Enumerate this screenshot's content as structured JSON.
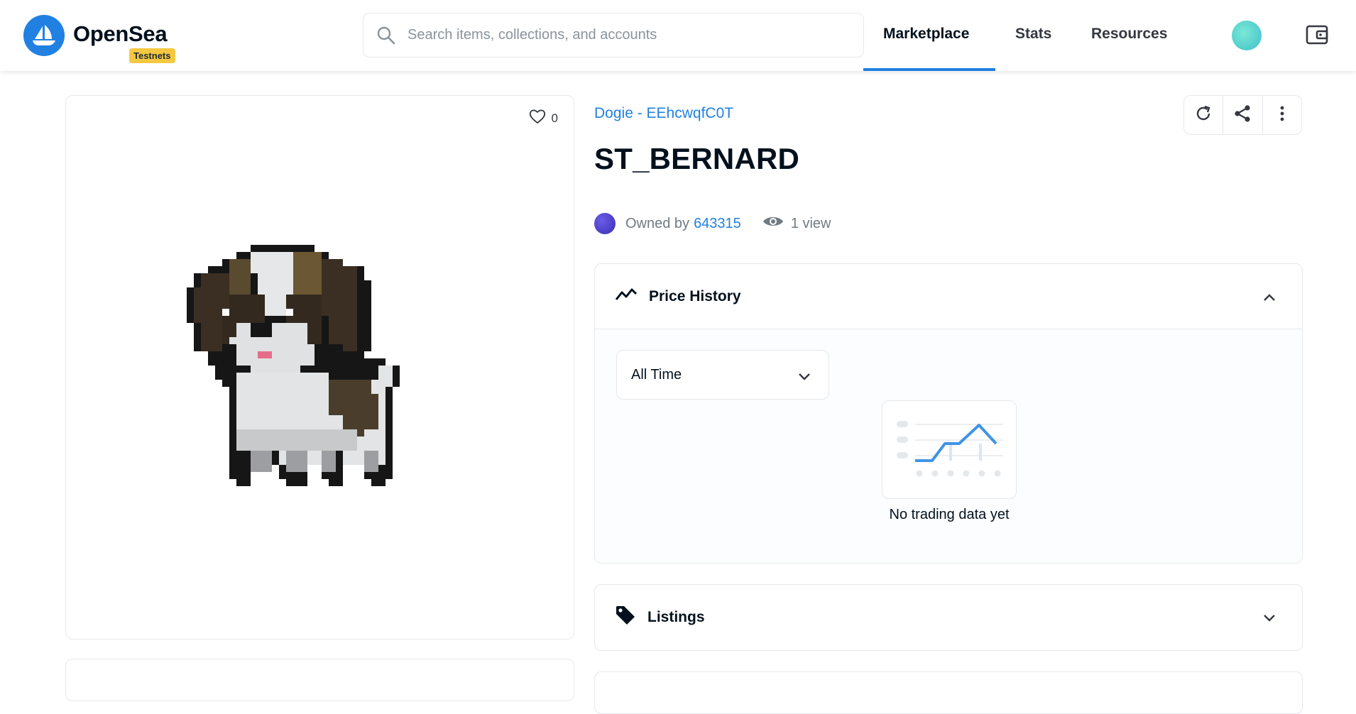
{
  "header": {
    "brand": "OpenSea",
    "badge": "Testnets",
    "search_placeholder": "Search items, collections, and accounts",
    "nav": [
      {
        "label": "Marketplace",
        "active": true
      },
      {
        "label": "Stats"
      },
      {
        "label": "Resources"
      }
    ],
    "accent_color": "#2081e2"
  },
  "item": {
    "favorites": "0",
    "collection": "Dogie - EEhcwqfC0T",
    "name": "ST_BERNARD",
    "owned_by_label": "Owned by",
    "owner": "643315",
    "views": "1 view"
  },
  "price_history": {
    "title": "Price History",
    "range": "All Time",
    "empty_message": "No trading data yet"
  },
  "listings": {
    "title": "Listings"
  },
  "icons": [
    "search-icon",
    "user-avatar",
    "wallet-icon",
    "heart-icon",
    "refresh-icon",
    "share-icon",
    "more-icon",
    "eye-icon",
    "trend-icon",
    "chevron-up-icon",
    "chevron-down-icon",
    "tag-icon"
  ]
}
